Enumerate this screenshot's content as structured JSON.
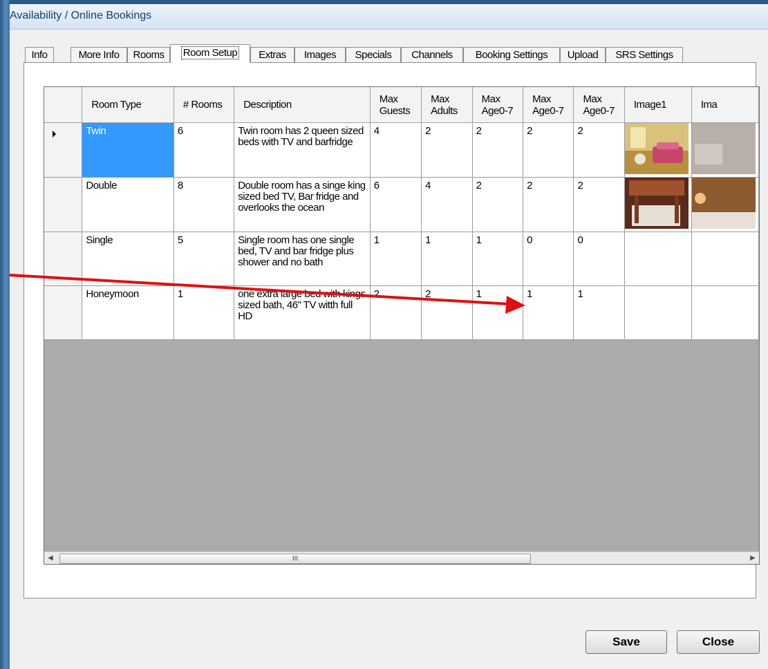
{
  "window": {
    "title": "Availability / Online Bookings"
  },
  "tabs": [
    {
      "label": "Info"
    },
    {
      "label": "More Info"
    },
    {
      "label": "Rooms"
    },
    {
      "label": "Room Setup",
      "active": true
    },
    {
      "label": "Extras"
    },
    {
      "label": "Images"
    },
    {
      "label": "Specials"
    },
    {
      "label": "Channels"
    },
    {
      "label": "Booking Settings"
    },
    {
      "label": "Upload"
    },
    {
      "label": "SRS Settings"
    }
  ],
  "grid": {
    "columns": {
      "room_type": "Room Type",
      "rooms": "# Rooms",
      "description": "Description",
      "max_guests": "Max Guests",
      "max_adults": "Max Adults",
      "max_age_a": "Max Age0-7",
      "max_age_b": "Max Age0-7",
      "max_age_c": "Max Age0-7",
      "image1": "Image1",
      "image2": "Ima"
    },
    "rows": [
      {
        "room_type": "Twin",
        "rooms": "6",
        "description": "Twin room has 2 queen sized beds with TV and barfridge",
        "max_guests": "4",
        "max_adults": "2",
        "max_age_a": "2",
        "max_age_b": "2",
        "max_age_c": "2"
      },
      {
        "room_type": "Double",
        "rooms": "8",
        "description": "Double room has a singe king sized bed TV, Bar fridge and overlooks the ocean",
        "max_guests": "6",
        "max_adults": "4",
        "max_age_a": "2",
        "max_age_b": "2",
        "max_age_c": "2"
      },
      {
        "room_type": "Single",
        "rooms": "5",
        "description": "Single room has one single bed, TV and bar fridge plus shower and no bath",
        "max_guests": "1",
        "max_adults": "1",
        "max_age_a": "1",
        "max_age_b": "0",
        "max_age_c": "0"
      },
      {
        "room_type": "Honeymoon",
        "rooms": "1",
        "description": "one extra large bed with kings sized bath, 46\" TV witth full HD",
        "max_guests": "2",
        "max_adults": "2",
        "max_age_a": "1",
        "max_age_b": "1",
        "max_age_c": "1"
      }
    ],
    "scroll_grip": "III"
  },
  "buttons": {
    "save": "Save",
    "close": "Close"
  },
  "colors": {
    "selection": "#3399ff",
    "annotation_arrow": "#e01010"
  }
}
